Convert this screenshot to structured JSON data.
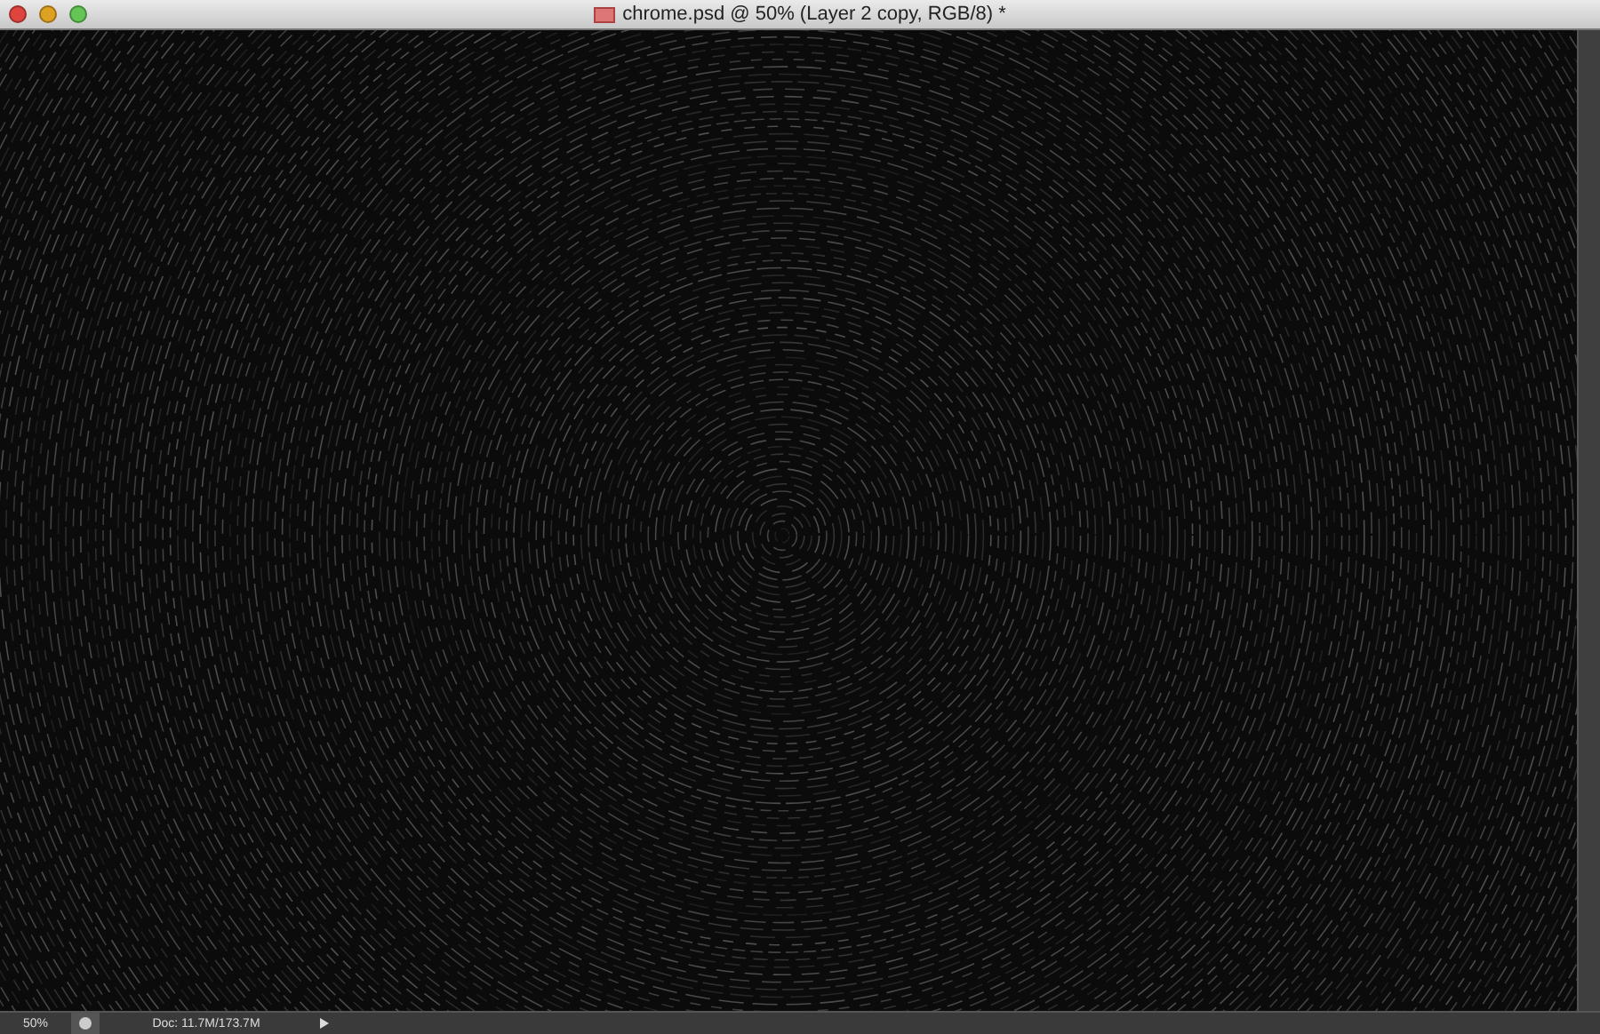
{
  "window": {
    "title": "chrome.psd @ 50% (Layer 2 copy, RGB/8) *"
  },
  "status_bar": {
    "zoom": "50%",
    "doc_info": "Doc: 11.7M/173.7M"
  }
}
